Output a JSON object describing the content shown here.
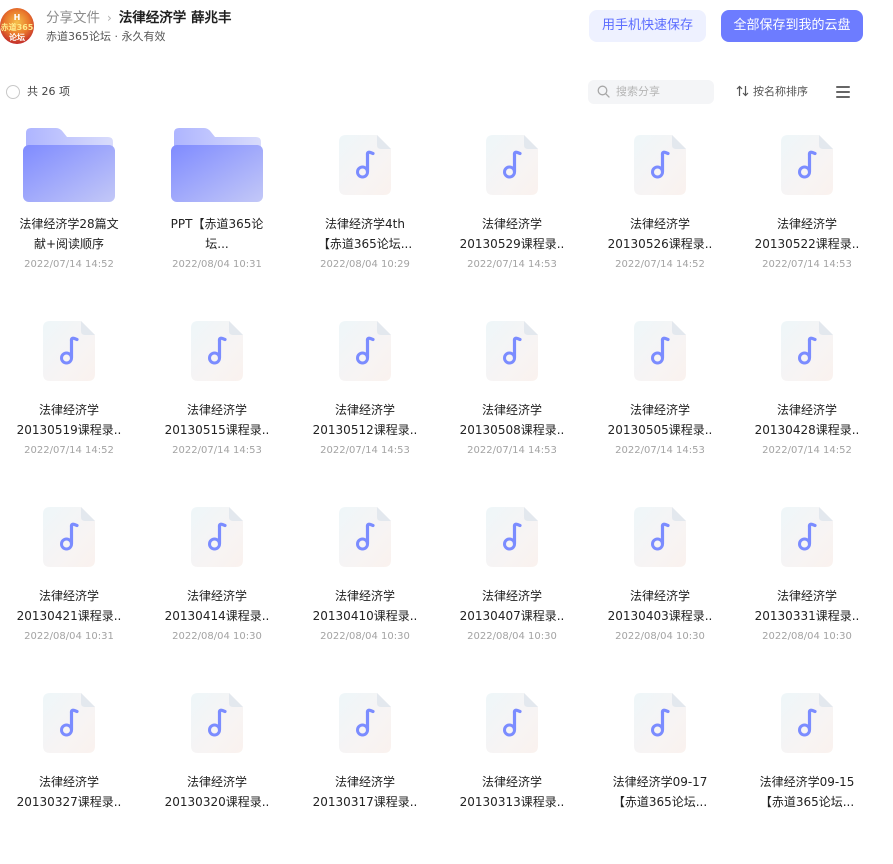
{
  "header": {
    "avatar_lines": [
      "H",
      "赤道365",
      "论坛"
    ],
    "breadcrumb_root": "分享文件",
    "breadcrumb_sep": "›",
    "title": "法律经济学 薛兆丰",
    "subtitle": "赤道365论坛 · 永久有效",
    "btn_phone": "用手机快速保存",
    "btn_save_all": "全部保存到我的云盘"
  },
  "toolbar": {
    "count": "共 26 项",
    "search_placeholder": "搜索分享",
    "sort_label": "按名称排序"
  },
  "colors": {
    "accent": "#6d7cff",
    "folder": "#8a95ff",
    "file_glyph": "#7b8cff"
  },
  "items": [
    {
      "type": "folder",
      "icon": "folder-icon",
      "name_lines": [
        "法律经济学28篇文",
        "献+阅读顺序"
      ],
      "date": "2022/07/14 14:52"
    },
    {
      "type": "folder",
      "icon": "folder-icon",
      "name_lines": [
        "PPT【赤道365论",
        "坛..."
      ],
      "date": "2022/08/04 10:31"
    },
    {
      "type": "audio",
      "icon": "audio-file-icon",
      "name_lines": [
        "法律经济学4th",
        "【赤道365论坛..."
      ],
      "date": "2022/08/04 10:29"
    },
    {
      "type": "audio",
      "icon": "audio-file-icon",
      "name_lines": [
        "法律经济学",
        "20130529课程录.."
      ],
      "date": "2022/07/14 14:53"
    },
    {
      "type": "audio",
      "icon": "audio-file-icon",
      "name_lines": [
        "法律经济学",
        "20130526课程录.."
      ],
      "date": "2022/07/14 14:52"
    },
    {
      "type": "audio",
      "icon": "audio-file-icon",
      "name_lines": [
        "法律经济学",
        "20130522课程录.."
      ],
      "date": "2022/07/14 14:53"
    },
    {
      "type": "audio",
      "icon": "audio-file-icon",
      "name_lines": [
        "法律经济学",
        "20130519课程录.."
      ],
      "date": "2022/07/14 14:52"
    },
    {
      "type": "audio",
      "icon": "audio-file-icon",
      "name_lines": [
        "法律经济学",
        "20130515课程录.."
      ],
      "date": "2022/07/14 14:53"
    },
    {
      "type": "audio",
      "icon": "audio-file-icon",
      "name_lines": [
        "法律经济学",
        "20130512课程录.."
      ],
      "date": "2022/07/14 14:53"
    },
    {
      "type": "audio",
      "icon": "audio-file-icon",
      "name_lines": [
        "法律经济学",
        "20130508课程录.."
      ],
      "date": "2022/07/14 14:53"
    },
    {
      "type": "audio",
      "icon": "audio-file-icon",
      "name_lines": [
        "法律经济学",
        "20130505课程录.."
      ],
      "date": "2022/07/14 14:53"
    },
    {
      "type": "audio",
      "icon": "audio-file-icon",
      "name_lines": [
        "法律经济学",
        "20130428课程录.."
      ],
      "date": "2022/07/14 14:52"
    },
    {
      "type": "audio",
      "icon": "audio-file-icon",
      "name_lines": [
        "法律经济学",
        "20130421课程录.."
      ],
      "date": "2022/08/04 10:31"
    },
    {
      "type": "audio",
      "icon": "audio-file-icon",
      "name_lines": [
        "法律经济学",
        "20130414课程录.."
      ],
      "date": "2022/08/04 10:30"
    },
    {
      "type": "audio",
      "icon": "audio-file-icon",
      "name_lines": [
        "法律经济学",
        "20130410课程录.."
      ],
      "date": "2022/08/04 10:30"
    },
    {
      "type": "audio",
      "icon": "audio-file-icon",
      "name_lines": [
        "法律经济学",
        "20130407课程录.."
      ],
      "date": "2022/08/04 10:30"
    },
    {
      "type": "audio",
      "icon": "audio-file-icon",
      "name_lines": [
        "法律经济学",
        "20130403课程录.."
      ],
      "date": "2022/08/04 10:30"
    },
    {
      "type": "audio",
      "icon": "audio-file-icon",
      "name_lines": [
        "法律经济学",
        "20130331课程录.."
      ],
      "date": "2022/08/04 10:30"
    },
    {
      "type": "audio",
      "icon": "audio-file-icon",
      "name_lines": [
        "法律经济学",
        "20130327课程录.."
      ],
      "date": ""
    },
    {
      "type": "audio",
      "icon": "audio-file-icon",
      "name_lines": [
        "法律经济学",
        "20130320课程录.."
      ],
      "date": ""
    },
    {
      "type": "audio",
      "icon": "audio-file-icon",
      "name_lines": [
        "法律经济学",
        "20130317课程录.."
      ],
      "date": ""
    },
    {
      "type": "audio",
      "icon": "audio-file-icon",
      "name_lines": [
        "法律经济学",
        "20130313课程录.."
      ],
      "date": ""
    },
    {
      "type": "audio",
      "icon": "audio-file-icon",
      "name_lines": [
        "法律经济学09-17",
        "【赤道365论坛..."
      ],
      "date": ""
    },
    {
      "type": "audio",
      "icon": "audio-file-icon",
      "name_lines": [
        "法律经济学09-15",
        "【赤道365论坛..."
      ],
      "date": ""
    }
  ]
}
